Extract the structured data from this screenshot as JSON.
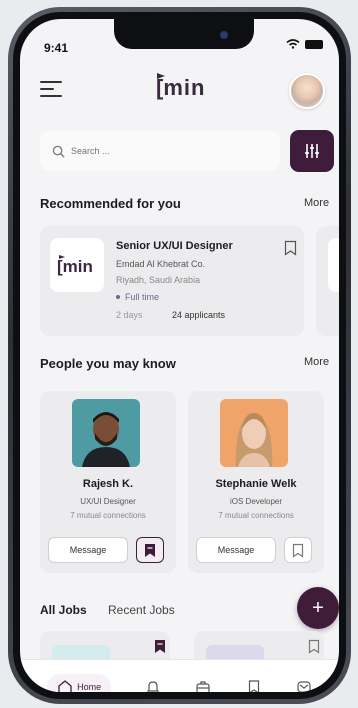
{
  "status": {
    "time": "9:41"
  },
  "brand": {
    "logo_text": "min"
  },
  "search": {
    "placeholder": "Search ..."
  },
  "recommended": {
    "title": "Recommended for you",
    "more": "More",
    "job": {
      "title": "Senior UX/UI Designer",
      "company": "Emdad Al Khebrat Co.",
      "location": "Riyadh, Saudi Arabia",
      "type": "Full time",
      "age": "2 days",
      "applicants": "24 applicants"
    }
  },
  "people": {
    "title": "People you may know",
    "more": "More",
    "items": [
      {
        "name": "Rajesh K.",
        "role": "UX/UI Designer",
        "mutual": "7 mutual connections",
        "message": "Message",
        "saved": true
      },
      {
        "name": "Stephanie Welk",
        "role": "iOS Developer",
        "mutual": "7 mutual connections",
        "message": "Message",
        "saved": false
      }
    ]
  },
  "tabs": {
    "all_jobs": "All Jobs",
    "recent_jobs": "Recent Jobs"
  },
  "fab": {
    "label": "+"
  },
  "nav": {
    "home": "Home"
  },
  "colors": {
    "primary": "#3f1d3a",
    "card": "#ececee",
    "background": "#f4f4f6"
  }
}
